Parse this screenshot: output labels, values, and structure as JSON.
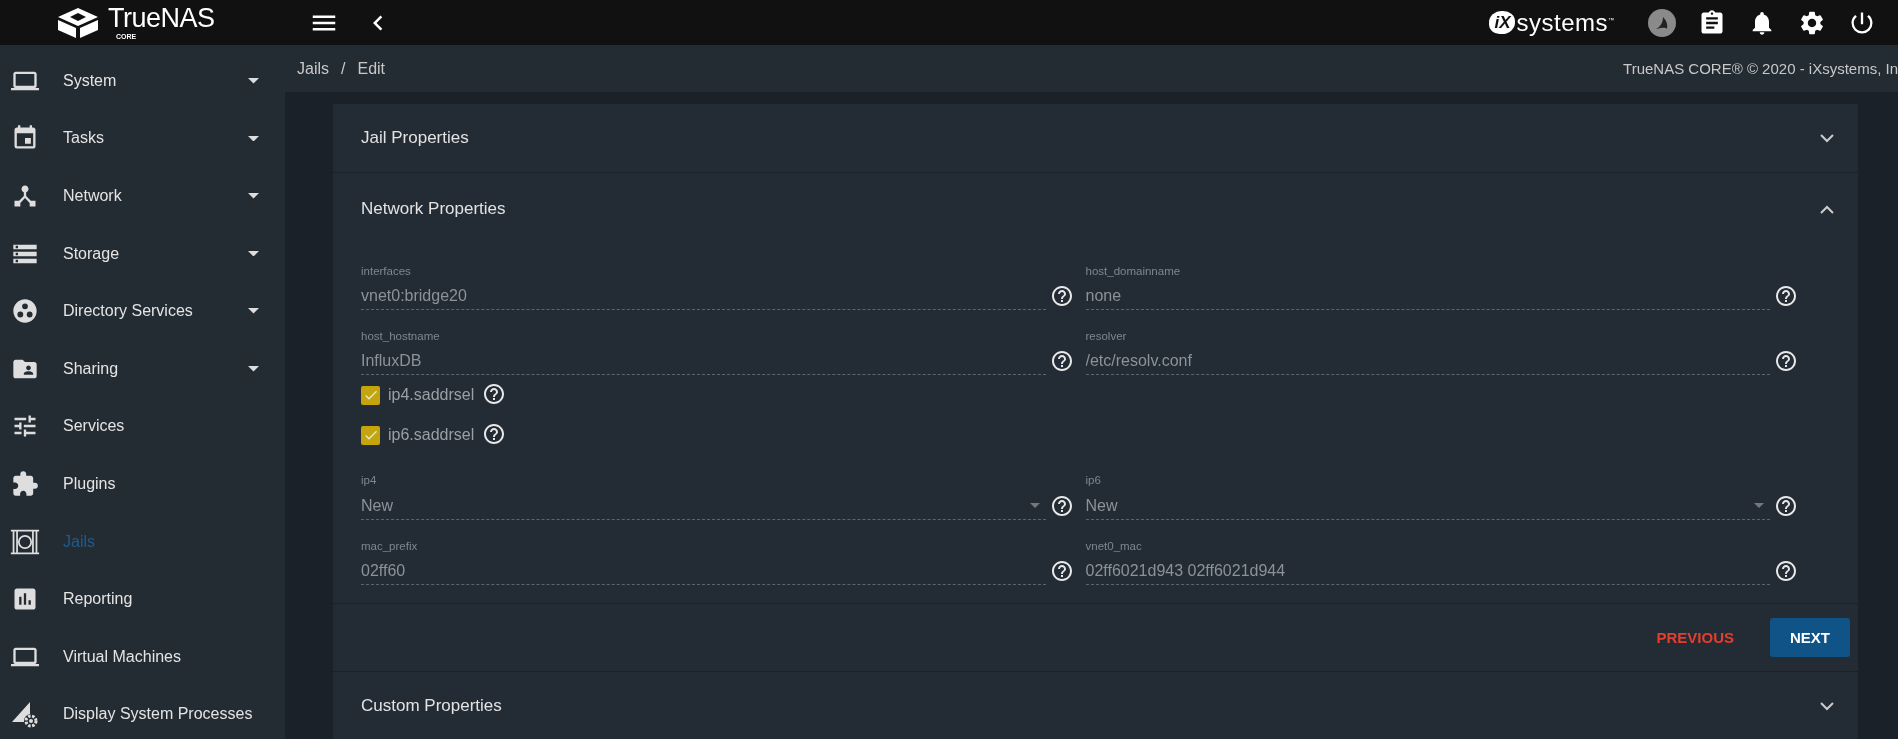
{
  "topbar": {
    "logo_name": "TrueNAS",
    "logo_edition": "CORE",
    "vendor_mark": "iX",
    "vendor_name": "systems",
    "vendor_tm": "™"
  },
  "sidebar": {
    "items": [
      {
        "label": "System",
        "has_menu": true,
        "selected": false
      },
      {
        "label": "Tasks",
        "has_menu": true,
        "selected": false
      },
      {
        "label": "Network",
        "has_menu": true,
        "selected": false
      },
      {
        "label": "Storage",
        "has_menu": true,
        "selected": false
      },
      {
        "label": "Directory Services",
        "has_menu": true,
        "selected": false
      },
      {
        "label": "Sharing",
        "has_menu": true,
        "selected": false
      },
      {
        "label": "Services",
        "has_menu": false,
        "selected": false
      },
      {
        "label": "Plugins",
        "has_menu": false,
        "selected": false
      },
      {
        "label": "Jails",
        "has_menu": false,
        "selected": true
      },
      {
        "label": "Reporting",
        "has_menu": false,
        "selected": false
      },
      {
        "label": "Virtual Machines",
        "has_menu": false,
        "selected": false
      },
      {
        "label": "Display System Processes",
        "has_menu": false,
        "selected": false
      }
    ]
  },
  "breadcrumb": {
    "items": [
      "Jails",
      "Edit"
    ],
    "separator": "/",
    "copyright": "TrueNAS CORE® © 2020 - iXsystems, In"
  },
  "sections": [
    {
      "title": "Jail Properties",
      "expanded": false
    },
    {
      "title": "Network Properties",
      "expanded": true,
      "fields": [
        {
          "kind": "input",
          "label": "interfaces",
          "value": "vnet0:bridge20"
        },
        {
          "kind": "input",
          "label": "host_domainname",
          "value": "none"
        },
        {
          "kind": "input",
          "label": "host_hostname",
          "value": "InfluxDB"
        },
        {
          "kind": "input",
          "label": "resolver",
          "value": "/etc/resolv.conf"
        },
        {
          "kind": "checkbox",
          "label": "ip4.saddrsel",
          "checked": true
        },
        {
          "kind": "checkbox",
          "label": "ip6.saddrsel",
          "checked": true
        },
        {
          "kind": "select",
          "label": "ip4",
          "value": "New"
        },
        {
          "kind": "select",
          "label": "ip6",
          "value": "New"
        },
        {
          "kind": "input",
          "label": "mac_prefix",
          "value": "02ff60"
        },
        {
          "kind": "input",
          "label": "vnet0_mac",
          "value": "02ff6021d943 02ff6021d944"
        }
      ],
      "buttons": [
        {
          "label": "PREVIOUS",
          "kind": "text"
        },
        {
          "label": "NEXT",
          "kind": "primary"
        }
      ]
    },
    {
      "title": "Custom Properties",
      "expanded": false
    }
  ]
}
